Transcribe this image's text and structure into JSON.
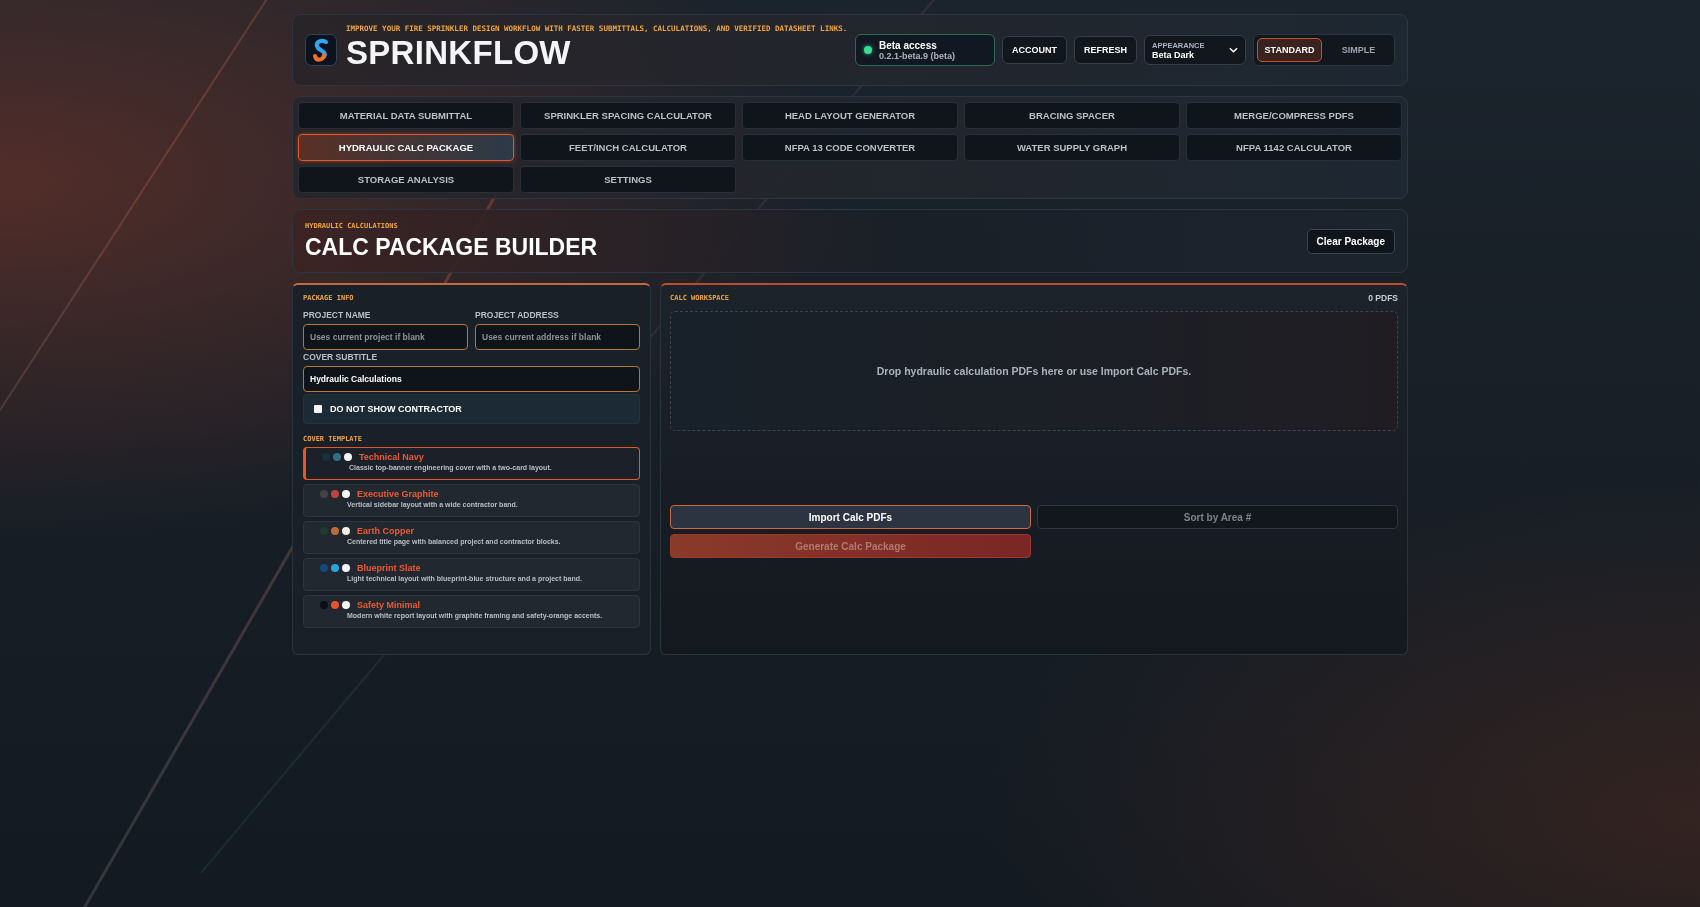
{
  "header": {
    "tagline": "IMPROVE YOUR FIRE SPRINKLER DESIGN WORKFLOW WITH FASTER SUBMITTALS, CALCULATIONS, AND VERIFIED DATASHEET LINKS.",
    "title": "SPRINKFLOW",
    "access": {
      "label": "Beta access",
      "version": "0.2.1-beta.9 (beta)",
      "online": true
    },
    "buttons": [
      "ACCOUNT",
      "REFRESH"
    ],
    "appearance": {
      "label": "APPEARANCE",
      "value": "Beta Dark"
    },
    "modes": [
      {
        "label": "STANDARD",
        "selected": true
      },
      {
        "label": "SIMPLE",
        "selected": false
      }
    ]
  },
  "nav": [
    {
      "label": "MATERIAL DATA SUBMITTAL",
      "selected": false
    },
    {
      "label": "SPRINKLER SPACING CALCULATOR",
      "selected": false
    },
    {
      "label": "HEAD LAYOUT GENERATOR",
      "selected": false
    },
    {
      "label": "BRACING SPACER",
      "selected": false
    },
    {
      "label": "MERGE/COMPRESS PDFS",
      "selected": false
    },
    {
      "label": "HYDRAULIC CALC PACKAGE",
      "selected": true
    },
    {
      "label": "FEET/INCH CALCULATOR",
      "selected": false
    },
    {
      "label": "NFPA 13 CODE CONVERTER",
      "selected": false
    },
    {
      "label": "WATER SUPPLY GRAPH",
      "selected": false
    },
    {
      "label": "NFPA 1142 CALCULATOR",
      "selected": false
    },
    {
      "label": "STORAGE ANALYSIS",
      "selected": false
    },
    {
      "label": "SETTINGS",
      "selected": false
    }
  ],
  "page": {
    "eyebrow": "HYDRAULIC CALCULATIONS",
    "title": "CALC PACKAGE BUILDER",
    "clear_button": "Clear Package"
  },
  "package_info": {
    "heading": "PACKAGE INFO",
    "fields": [
      {
        "label": "PROJECT NAME",
        "placeholder": "Uses current project if blank"
      },
      {
        "label": "PROJECT ADDRESS",
        "placeholder": "Uses current address if blank"
      }
    ],
    "subtitle": {
      "label": "COVER SUBTITLE",
      "value": "Hydraulic Calculations"
    },
    "hide_contractor": {
      "label": "DO NOT SHOW CONTRACTOR",
      "checked": false
    },
    "template_heading": "COVER TEMPLATE",
    "templates": [
      {
        "name": "Technical Navy",
        "description": "Classic top-banner engineering cover with a two-card layout.",
        "selected": true,
        "swatches": [
          {
            "color": "#16323f"
          },
          {
            "color": "#2e6f86"
          },
          {
            "color": "#f3f4f6"
          }
        ]
      },
      {
        "name": "Executive Graphite",
        "description": "Vertical sidebar layout with a wide contractor band.",
        "selected": false,
        "swatches": [
          {
            "color": "#444444"
          },
          {
            "color": "#c0443a"
          },
          {
            "color": "#f5f5f5"
          }
        ]
      },
      {
        "name": "Earth Copper",
        "description": "Centered title page with balanced project and contractor blocks.",
        "selected": false,
        "swatches": [
          {
            "color": "#223a30"
          },
          {
            "color": "#b86b3e"
          },
          {
            "color": "#f5efe6"
          }
        ]
      },
      {
        "name": "Blueprint Slate",
        "description": "Light technical layout with blueprint-blue structure and a project band.",
        "selected": false,
        "swatches": [
          {
            "color": "#124a80"
          },
          {
            "color": "#2aa4dc"
          },
          {
            "color": "#f4f7fa"
          }
        ]
      },
      {
        "name": "Safety Minimal",
        "description": "Modern white report layout with graphite framing and safety-orange accents.",
        "selected": false,
        "swatches": [
          {
            "color": "#0c0f15"
          },
          {
            "color": "#e8532a"
          },
          {
            "color": "#f8f8f8"
          }
        ]
      }
    ]
  },
  "workspace": {
    "heading": "CALC WORKSPACE",
    "count": "0 PDFS",
    "drop_text": "Drop hydraulic calculation PDFs here or use Import Calc PDFs.",
    "actions": [
      {
        "label": "Import Calc PDFs",
        "kind": "primary",
        "disabled": false
      },
      {
        "label": "Sort by Area #",
        "kind": "secondary",
        "disabled": true
      },
      {
        "label": "Generate Calc Package",
        "kind": "generate",
        "disabled": true
      }
    ]
  }
}
